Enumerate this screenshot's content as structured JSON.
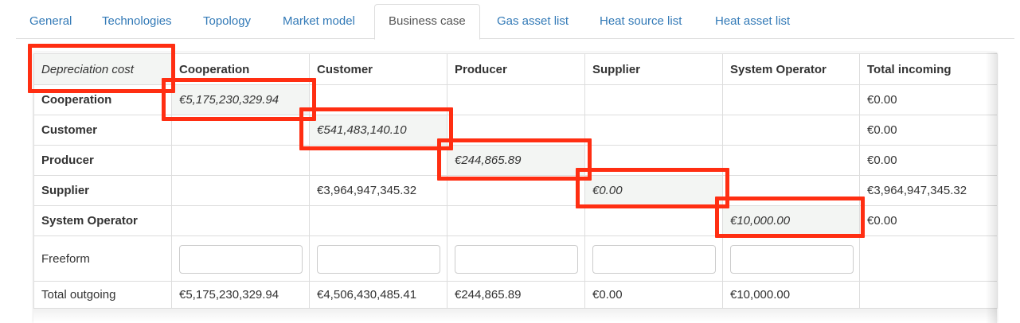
{
  "tabs": [
    {
      "label": "General",
      "active": false
    },
    {
      "label": "Technologies",
      "active": false
    },
    {
      "label": "Topology",
      "active": false
    },
    {
      "label": "Market model",
      "active": false
    },
    {
      "label": "Business case",
      "active": true
    },
    {
      "label": "Gas asset list",
      "active": false
    },
    {
      "label": "Heat source list",
      "active": false
    },
    {
      "label": "Heat asset list",
      "active": false
    }
  ],
  "table": {
    "corner": "Depreciation cost",
    "columns": [
      "Cooperation",
      "Customer",
      "Producer",
      "Supplier",
      "System Operator",
      "Total incoming"
    ],
    "rows": [
      {
        "label": "Cooperation",
        "cells": [
          "€5,175,230,329.94",
          "",
          "",
          "",
          "",
          "€0.00"
        ]
      },
      {
        "label": "Customer",
        "cells": [
          "",
          "€541,483,140.10",
          "",
          "",
          "",
          "€0.00"
        ]
      },
      {
        "label": "Producer",
        "cells": [
          "",
          "",
          "€244,865.89",
          "",
          "",
          "€0.00"
        ]
      },
      {
        "label": "Supplier",
        "cells": [
          "",
          "€3,964,947,345.32",
          "",
          "€0.00",
          "",
          "€3,964,947,345.32"
        ]
      },
      {
        "label": "System Operator",
        "cells": [
          "",
          "",
          "",
          "",
          "€10,000.00",
          "€0.00"
        ]
      }
    ],
    "freeform_label": "Freeform",
    "freeform_values": [
      "",
      "",
      "",
      "",
      ""
    ],
    "total_label": "Total outgoing",
    "totals": [
      "€5,175,230,329.94",
      "€4,506,430,485.41",
      "€244,865.89",
      "€0.00",
      "€10,000.00",
      ""
    ]
  },
  "colors": {
    "highlight": "#ff2e12",
    "link": "#337ab7",
    "diagonal_bg": "#f3f5f3"
  }
}
